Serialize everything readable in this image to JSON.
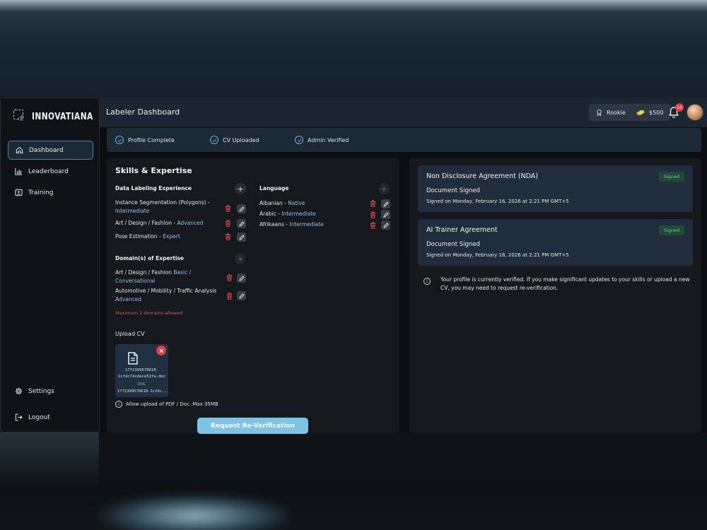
{
  "app": {
    "brand": "INNOVATIANA",
    "page_title": "Labeler Dashboard"
  },
  "sidebar": {
    "items": [
      {
        "label": "Dashboard",
        "icon": "home-icon",
        "active": true
      },
      {
        "label": "Leaderboard",
        "icon": "bar-chart-icon",
        "active": false
      },
      {
        "label": "Training",
        "icon": "training-icon",
        "active": false
      }
    ],
    "settings_label": "Settings",
    "logout_label": "Logout"
  },
  "header": {
    "rank_label": "Rookie",
    "balance": "$500",
    "notification_count": "10"
  },
  "status": [
    {
      "label": "Profile Complete"
    },
    {
      "label": "CV Uploaded"
    },
    {
      "label": "Admin Verified"
    }
  ],
  "skills": {
    "title": "Skills & Expertise",
    "labeling": {
      "title": "Data Labeling Experience",
      "items": [
        {
          "name": "Instance Segmentation (Polygons)",
          "sep": " - ",
          "level": "Intermediate"
        },
        {
          "name": "Art / Design / Fashion",
          "sep": " - ",
          "level": "Advanced"
        },
        {
          "name": "Pose Estimation",
          "sep": " - ",
          "level": "Expert"
        }
      ]
    },
    "language": {
      "title": "Language",
      "items": [
        {
          "name": "Albanian",
          "sep": " - ",
          "level": "Native"
        },
        {
          "name": "Arabic",
          "sep": " - ",
          "level": "Intermediate"
        },
        {
          "name": "Afrikaans",
          "sep": " - ",
          "level": "Intermediate"
        }
      ]
    },
    "domains": {
      "title": "Domain(s) of Expertise",
      "items": [
        {
          "name": "Art / Design / Fashion",
          "level": "Basic / Conversational"
        },
        {
          "name": "Automotive / Mobility / Traffic Analysis",
          "level": "Advanced"
        }
      ],
      "warning": "Maximum 2 domains allowed"
    }
  },
  "upload": {
    "label": "Upload CV",
    "file_name_line1": "1771399570610-",
    "file_name_line2": "1cfdc74cdece51fa.doc",
    "file_type": "DOC",
    "file_caption": "1771399570610-1cfdc...",
    "hint": "Allow upload of PDF / Doc .Max 05MB"
  },
  "reverify_label": "Request Re-Verification",
  "agreements": [
    {
      "title": "Non Disclosure Agreement (NDA)",
      "status": "Document Signed",
      "date": "Signed on Monday, February 16, 2026 at 2:21 PM GMT+5",
      "badge": "Signed"
    },
    {
      "title": "AI Trainer Agreement",
      "status": "Document Signed",
      "date": "Signed on Monday, February 16, 2026 at 2:21 PM GMT+5",
      "badge": "Signed"
    }
  ],
  "verification_note": "Your profile is currently verified. If you make significant updates to your skills or upload a new CV, you may need to request re-verification.",
  "colors": {
    "accent": "#7cc3e6",
    "danger": "#e53945",
    "success": "#5dd39a",
    "level": "#8fc3e0"
  }
}
